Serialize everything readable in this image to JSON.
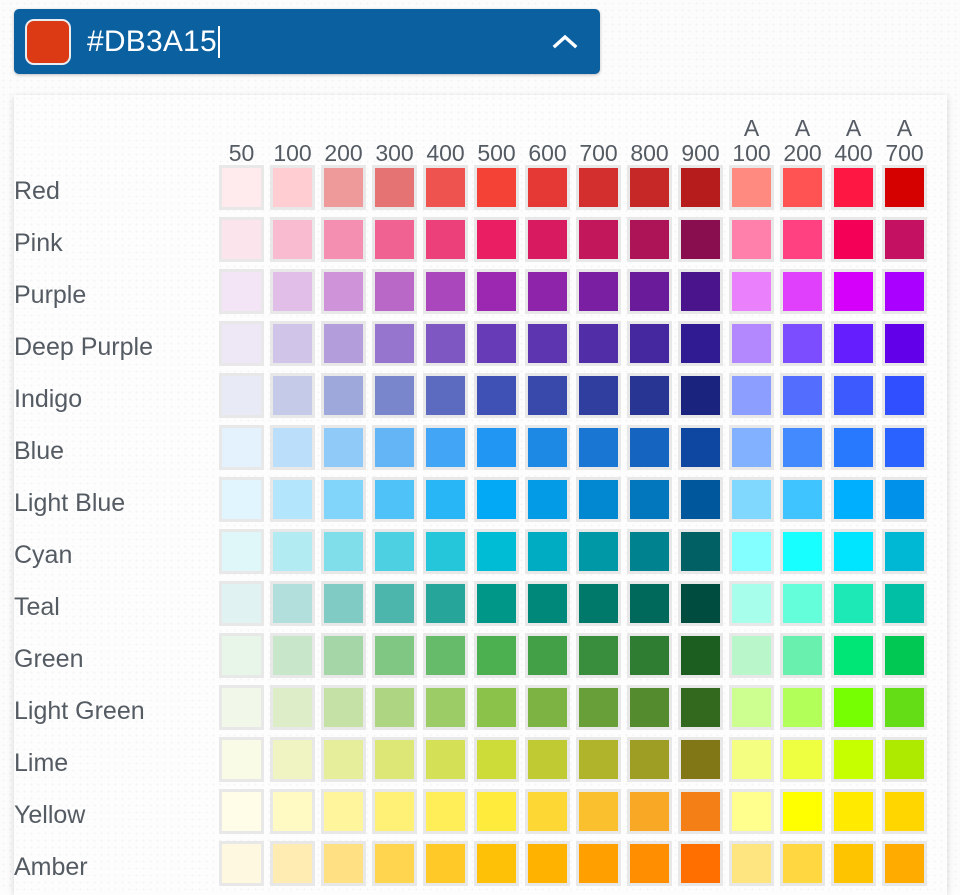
{
  "header": {
    "hex_value": "#DB3A15",
    "current_color": "#DB3A15",
    "collapse_icon": "chevron-up-icon",
    "background_color": "#0B60A0",
    "text_color": "#FFFFFF"
  },
  "palette": {
    "shade_columns": [
      "50",
      "100",
      "200",
      "300",
      "400",
      "500",
      "600",
      "700",
      "800",
      "900"
    ],
    "accent_prefix": "A",
    "accent_columns": [
      "100",
      "200",
      "400",
      "700"
    ],
    "rows": [
      {
        "name": "Red",
        "swatches": [
          "#FFEBEE",
          "#FFCDD2",
          "#EF9A9A",
          "#E57373",
          "#EF5350",
          "#F44336",
          "#E53935",
          "#D32F2F",
          "#C62828",
          "#B71C1C",
          "#FF8A80",
          "#FF5252",
          "#FF1744",
          "#D50000"
        ]
      },
      {
        "name": "Pink",
        "swatches": [
          "#FCE4EC",
          "#F8BBD0",
          "#F48FB1",
          "#F06292",
          "#EC407A",
          "#E91E63",
          "#D81B60",
          "#C2185B",
          "#AD1457",
          "#880E4F",
          "#FF80AB",
          "#FF4081",
          "#F50057",
          "#C51162"
        ]
      },
      {
        "name": "Purple",
        "swatches": [
          "#F3E5F5",
          "#E1BEE7",
          "#CE93D8",
          "#BA68C8",
          "#AB47BC",
          "#9C27B0",
          "#8E24AA",
          "#7B1FA2",
          "#6A1B9A",
          "#4A148C",
          "#EA80FC",
          "#E040FB",
          "#D500F9",
          "#AA00FF"
        ]
      },
      {
        "name": "Deep Purple",
        "swatches": [
          "#EDE7F6",
          "#D1C4E9",
          "#B39DDB",
          "#9575CD",
          "#7E57C2",
          "#673AB7",
          "#5E35B1",
          "#512DA8",
          "#4527A0",
          "#311B92",
          "#B388FF",
          "#7C4DFF",
          "#651FFF",
          "#6200EA"
        ]
      },
      {
        "name": "Indigo",
        "swatches": [
          "#E8EAF6",
          "#C5CAE9",
          "#9FA8DA",
          "#7986CB",
          "#5C6BC0",
          "#3F51B5",
          "#3949AB",
          "#303F9F",
          "#283593",
          "#1A237E",
          "#8C9EFF",
          "#536DFE",
          "#3D5AFE",
          "#304FFE"
        ]
      },
      {
        "name": "Blue",
        "swatches": [
          "#E3F2FD",
          "#BBDEFB",
          "#90CAF9",
          "#64B5F6",
          "#42A5F5",
          "#2196F3",
          "#1E88E5",
          "#1976D2",
          "#1565C0",
          "#0D47A1",
          "#82B1FF",
          "#448AFF",
          "#2979FF",
          "#2962FF"
        ]
      },
      {
        "name": "Light Blue",
        "swatches": [
          "#E1F5FE",
          "#B3E5FC",
          "#81D4FA",
          "#4FC3F7",
          "#29B6F6",
          "#03A9F4",
          "#039BE5",
          "#0288D1",
          "#0277BD",
          "#01579B",
          "#80D8FF",
          "#40C4FF",
          "#00B0FF",
          "#0091EA"
        ]
      },
      {
        "name": "Cyan",
        "swatches": [
          "#E0F7FA",
          "#B2EBF2",
          "#80DEEA",
          "#4DD0E1",
          "#26C6DA",
          "#00BCD4",
          "#00ACC1",
          "#0097A7",
          "#00838F",
          "#006064",
          "#84FFFF",
          "#18FFFF",
          "#00E5FF",
          "#00B8D4"
        ]
      },
      {
        "name": "Teal",
        "swatches": [
          "#E0F2F1",
          "#B2DFDB",
          "#80CBC4",
          "#4DB6AC",
          "#26A69A",
          "#009688",
          "#00897B",
          "#00796B",
          "#00695C",
          "#004D40",
          "#A7FFEB",
          "#64FFDA",
          "#1DE9B6",
          "#00BFA5"
        ]
      },
      {
        "name": "Green",
        "swatches": [
          "#E8F5E9",
          "#C8E6C9",
          "#A5D6A7",
          "#81C784",
          "#66BB6A",
          "#4CAF50",
          "#43A047",
          "#388E3C",
          "#2E7D32",
          "#1B5E20",
          "#B9F6CA",
          "#69F0AE",
          "#00E676",
          "#00C853"
        ]
      },
      {
        "name": "Light Green",
        "swatches": [
          "#F1F8E9",
          "#DCEDC8",
          "#C5E1A5",
          "#AED581",
          "#9CCC65",
          "#8BC34A",
          "#7CB342",
          "#689F38",
          "#558B2F",
          "#33691E",
          "#CCFF90",
          "#B2FF59",
          "#76FF03",
          "#64DD17"
        ]
      },
      {
        "name": "Lime",
        "swatches": [
          "#F9FBE7",
          "#F0F4C3",
          "#E6EE9C",
          "#DCE775",
          "#D4E157",
          "#CDDC39",
          "#C0CA33",
          "#AFB42B",
          "#9E9D24",
          "#827717",
          "#F4FF81",
          "#EEFF41",
          "#C6FF00",
          "#AEEA00"
        ]
      },
      {
        "name": "Yellow",
        "swatches": [
          "#FFFDE7",
          "#FFF9C4",
          "#FFF59D",
          "#FFF176",
          "#FFEE58",
          "#FFEB3B",
          "#FDD835",
          "#FBC02D",
          "#F9A825",
          "#F57F17",
          "#FFFF8D",
          "#FFFF00",
          "#FFEA00",
          "#FFD600"
        ]
      },
      {
        "name": "Amber",
        "swatches": [
          "#FFF8E1",
          "#FFECB3",
          "#FFE082",
          "#FFD54F",
          "#FFCA28",
          "#FFC107",
          "#FFB300",
          "#FFA000",
          "#FF8F00",
          "#FF6F00",
          "#FFE57F",
          "#FFD740",
          "#FFC400",
          "#FFAB00"
        ]
      }
    ]
  }
}
